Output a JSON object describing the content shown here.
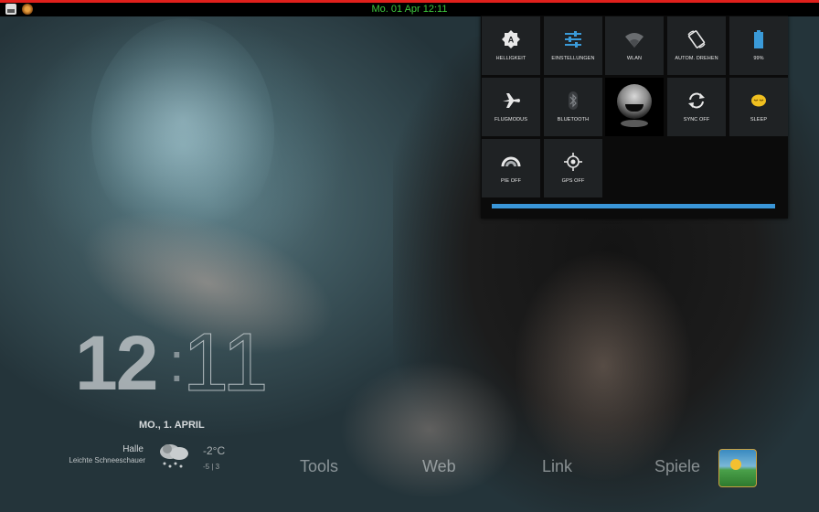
{
  "status_bar": {
    "clock": "Mo. 01 Apr 12:11",
    "left_icons": [
      "photo-icon",
      "app-icon"
    ],
    "accent_color": "#e0201c",
    "clock_color": "#3ec83e"
  },
  "quick_settings": {
    "tiles": [
      {
        "label": "HELLIGKEIT",
        "icon": "brightness-icon"
      },
      {
        "label": "EINSTELLUNGEN",
        "icon": "settings-sliders-icon"
      },
      {
        "label": "WLAN",
        "icon": "wifi-icon"
      },
      {
        "label": "AUTOM. DREHEN",
        "icon": "auto-rotate-icon"
      },
      {
        "label": "99%",
        "icon": "battery-icon"
      },
      {
        "label": "FLUGMODUS",
        "icon": "airplane-icon"
      },
      {
        "label": "BLUETOOTH",
        "icon": "bluetooth-icon"
      },
      {
        "label": "",
        "icon": "user-avatar"
      },
      {
        "label": "SYNC OFF",
        "icon": "sync-icon"
      },
      {
        "label": "SLEEP",
        "icon": "sleep-icon"
      },
      {
        "label": "PIE OFF",
        "icon": "pie-icon"
      },
      {
        "label": "GPS OFF",
        "icon": "gps-icon"
      }
    ],
    "brightness_level": 1.0,
    "progress_color": "#3a96d8"
  },
  "lockscreen": {
    "hours": "12",
    "minutes": "11",
    "date": "MO., 1. APRIL",
    "weather": {
      "city": "Halle",
      "description": "Leichte Schneeschauer",
      "temperature": "-2°C",
      "range": "-5 | 3",
      "icon": "snow-cloud-icon"
    }
  },
  "dock": {
    "items": [
      "Tools",
      "Web",
      "Link",
      "Spiele"
    ],
    "app_icon": "landscape-app-icon"
  }
}
